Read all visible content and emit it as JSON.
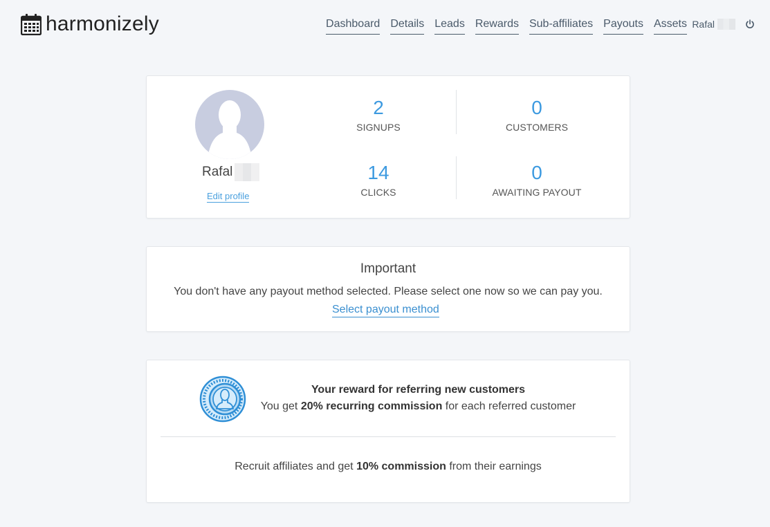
{
  "app": {
    "name": "harmonizely",
    "icon": "calendar-icon"
  },
  "nav": {
    "items": [
      {
        "label": "Dashboard"
      },
      {
        "label": "Details"
      },
      {
        "label": "Leads"
      },
      {
        "label": "Rewards"
      },
      {
        "label": "Sub-affiliates"
      },
      {
        "label": "Payouts"
      },
      {
        "label": "Assets"
      }
    ]
  },
  "user": {
    "first_name": "Rafal",
    "logout_icon": "power-icon"
  },
  "profile": {
    "name": "Rafal",
    "edit_label": "Edit profile",
    "avatar_icon": "user-silhouette-icon"
  },
  "stats": {
    "signups": {
      "value": "2",
      "label": "SIGNUPS"
    },
    "customers": {
      "value": "0",
      "label": "CUSTOMERS"
    },
    "clicks": {
      "value": "14",
      "label": "CLICKS"
    },
    "awaiting": {
      "value": "0",
      "label": "AWAITING PAYOUT"
    }
  },
  "important": {
    "title": "Important",
    "message": "You don't have any payout method selected. Please select one now so we can pay you.",
    "link": "Select payout method"
  },
  "reward": {
    "icon": "coin-icon",
    "title": "Your reward for referring new customers",
    "prefix": "You get ",
    "highlight": "20% recurring commission",
    "suffix": " for each referred customer",
    "sub_prefix": "Recruit affiliates and get ",
    "sub_highlight": "10% commission",
    "sub_suffix": " from their earnings"
  },
  "colors": {
    "accent": "#3d9ae0",
    "background": "#f4f6f9",
    "avatar_bg": "#c8cde0"
  }
}
